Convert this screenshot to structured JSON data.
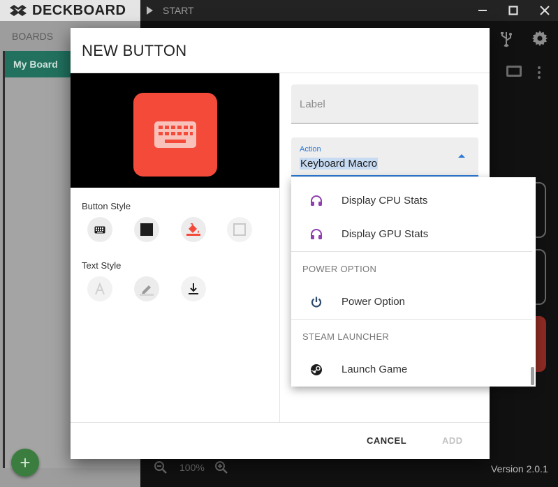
{
  "app": {
    "brand": "DECKBOARD",
    "start_label": "START",
    "boards_label": "BOARDS",
    "board_name": "My Board",
    "fab_symbol": "+",
    "zoom_level": "100%",
    "version": "Version 2.0.1"
  },
  "dialog": {
    "title": "NEW BUTTON",
    "label_placeholder": "Label",
    "action_caption": "Action",
    "action_value": "Keyboard Macro",
    "button_style_label": "Button Style",
    "text_style_label": "Text Style",
    "cancel_label": "CANCEL",
    "add_label": "ADD",
    "preview_color": "#f44a3a"
  },
  "dropdown": {
    "items": [
      {
        "label": "Display CPU Stats",
        "icon": "headphones-icon"
      },
      {
        "label": "Display GPU Stats",
        "icon": "headphones-icon"
      }
    ],
    "power_header": "POWER OPTION",
    "power_item": {
      "label": "Power Option",
      "icon": "power-icon"
    },
    "steam_header": "STEAM LAUNCHER",
    "steam_item": {
      "label": "Launch Game",
      "icon": "steam-icon"
    }
  },
  "colors": {
    "accent": "#2b79d4",
    "board_active": "#21715e",
    "stats_icon": "#8e3fb0",
    "power_icon": "#2d4a6b"
  }
}
